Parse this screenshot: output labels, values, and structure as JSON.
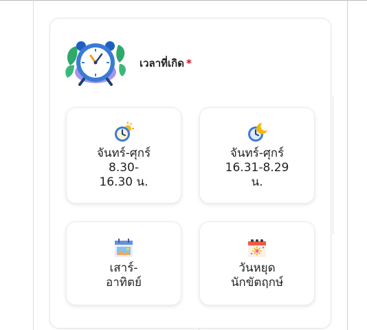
{
  "section": {
    "title": "เวลาที่เกิด",
    "required_marker": "*"
  },
  "options": [
    {
      "icon": "sun-clock-icon",
      "lines": [
        "จันทร์-ศุกร์",
        "8.30-",
        "16.30 น."
      ]
    },
    {
      "icon": "moon-clock-icon",
      "lines": [
        "จันทร์-ศุกร์",
        "16.31-8.29",
        "น."
      ]
    },
    {
      "icon": "calendar-weekend-icon",
      "lines": [
        "เสาร์-",
        "อาทิตย์"
      ]
    },
    {
      "icon": "calendar-holiday-icon",
      "lines": [
        "วันหยุด",
        "นักขัตฤกษ์"
      ]
    }
  ],
  "colors": {
    "required": "#e3001b",
    "clock_face": "#3a7bd5",
    "sun": "#f7b733",
    "moon": "#f5b700"
  }
}
